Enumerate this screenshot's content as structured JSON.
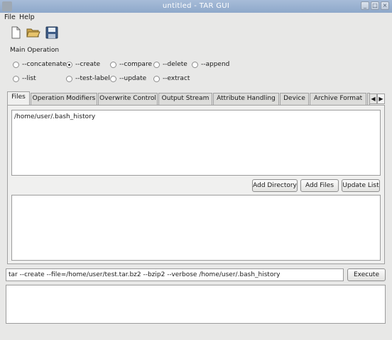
{
  "window": {
    "title": "untitled - TAR GUI"
  },
  "menubar": {
    "items": [
      "File",
      "Help"
    ]
  },
  "toolbar": {
    "icons": [
      "new-file-icon",
      "open-folder-icon",
      "save-icon"
    ]
  },
  "main_operation": {
    "label": "Main Operation",
    "options": [
      {
        "label": "--concatenate",
        "selected": false
      },
      {
        "label": "--create",
        "selected": true
      },
      {
        "label": "--compare",
        "selected": false
      },
      {
        "label": "--delete",
        "selected": false
      },
      {
        "label": "--append",
        "selected": false
      },
      {
        "label": "--list",
        "selected": false
      },
      {
        "label": "--test-label",
        "selected": false
      },
      {
        "label": "--update",
        "selected": false
      },
      {
        "label": "--extract",
        "selected": false
      }
    ]
  },
  "tabs": [
    {
      "label": "Files",
      "active": true
    },
    {
      "label": "Operation Modifiers",
      "active": false
    },
    {
      "label": "Overwrite Control",
      "active": false
    },
    {
      "label": "Output Stream",
      "active": false
    },
    {
      "label": "Attribute Handling",
      "active": false
    },
    {
      "label": "Device",
      "active": false
    },
    {
      "label": "Archive Format",
      "active": false
    }
  ],
  "files_tab": {
    "file_list": [
      "/home/user/.bash_history"
    ],
    "buttons": {
      "add_directory": "Add Directory",
      "add_files": "Add Files",
      "update_list": "Update List"
    }
  },
  "command": {
    "value": "tar --create --file=/home/user/test.tar.bz2 --bzip2 --verbose  /home/user/.bash_history",
    "execute_label": "Execute"
  }
}
